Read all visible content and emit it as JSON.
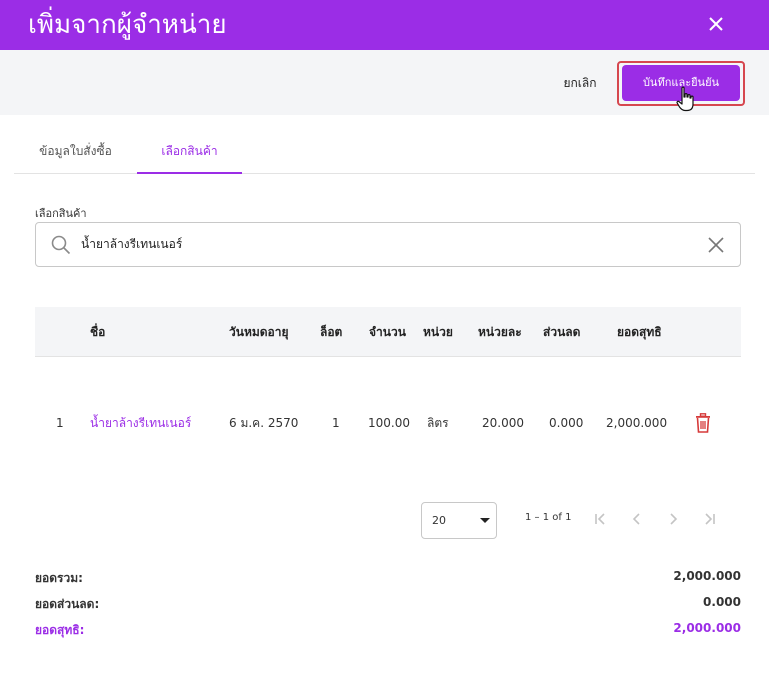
{
  "dialog": {
    "title": "เพิ่มจากผู้จำหน่าย"
  },
  "toolbar": {
    "cancel_label": "ยกเลิก",
    "save_label": "บันทึกและยืนยัน"
  },
  "tabs": [
    {
      "label": "ข้อมูลใบสั่งซื้อ",
      "active": false
    },
    {
      "label": "เลือกสินค้า",
      "active": true
    }
  ],
  "product_search": {
    "label": "เลือกสินค้า",
    "value": "น้ำยาล้างรีเทนเนอร์"
  },
  "table": {
    "headers": {
      "name": "ชื่อ",
      "expiry": "วันหมดอายุ",
      "lot": "ล็อต",
      "quantity": "จำนวน",
      "unit": "หน่วย",
      "unit_price": "หน่วยละ",
      "discount": "ส่วนลด",
      "net": "ยอดสุทธิ"
    },
    "rows": [
      {
        "index": "1",
        "name": "น้ำยาล้างรีเทนเนอร์",
        "expiry": "6 ม.ค. 2570",
        "lot": "1",
        "quantity": "100.00",
        "unit": "ลิตร",
        "unit_price": "20.000",
        "discount": "0.000",
        "net": "2,000.000"
      }
    ]
  },
  "pagination": {
    "rows_per_page": "20",
    "range": "1 – 1 of 1"
  },
  "summary": {
    "total_label": "ยอดรวม:",
    "total_value": "2,000.000",
    "discount_label": "ยอดส่วนลด:",
    "discount_value": "0.000",
    "net_label": "ยอดสุทธิ:",
    "net_value": "2,000.000"
  },
  "colors": {
    "accent": "#9b2de6",
    "highlight_outline": "#d6474f",
    "delete": "#d63a3a"
  },
  "icons": [
    "close-icon",
    "search-icon",
    "clear-icon",
    "trash-icon",
    "first-page-icon",
    "prev-page-icon",
    "next-page-icon",
    "last-page-icon",
    "hand-cursor-icon",
    "dropdown-caret-icon"
  ]
}
